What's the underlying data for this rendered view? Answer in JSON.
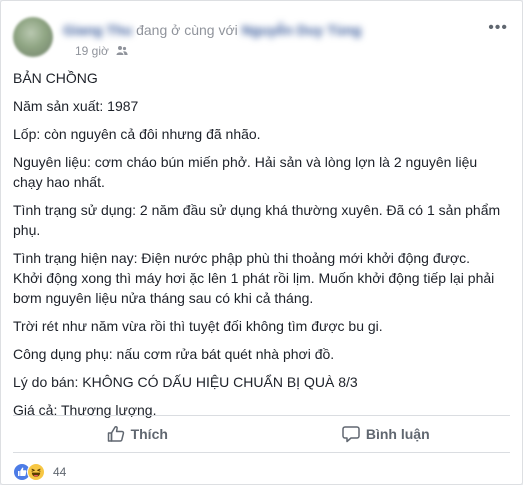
{
  "header": {
    "author_name": "Giang Thu",
    "with_text": "đang ở cùng với",
    "tagged_name": "Nguyễn Duy Tùng",
    "timestamp": "19 giờ",
    "audience_icon": "friends-icon",
    "more_icon": "more-icon"
  },
  "post": {
    "lines": [
      "BẢN CHỒNG",
      "Năm sản xuất: 1987",
      "Lốp: còn nguyên cả đôi nhưng đã nhão.",
      "Nguyên liệu: cơm cháo bún miến phở. Hải sản và lòng lợn là 2 nguyên liệu chạy hao nhất.",
      "Tình trạng sử dụng: 2 năm đầu sử dụng khá thường xuyên. Đã có 1 sản phẩm phụ.",
      "Tình trạng hiện nay: Điện nước phập phù thi thoảng mới khởi động được. Khởi động xong thì máy hơi ặc lên 1 phát rồi lịm. Muốn khởi động tiếp lại phải bơm nguyên liệu nửa tháng sau có khi cả tháng.",
      "Trời rét như năm vừa rồi thì tuyệt đối không tìm được bu gi.",
      "Công dụng phụ: nấu cơm rửa bát quét nhà phơi đồ.",
      "Lý do bán: KHÔNG CÓ DẤU HIỆU CHUẨN BỊ QUÀ 8/3",
      "Giá cả: Thương lượng."
    ]
  },
  "actions": {
    "like_label": "Thích",
    "comment_label": "Bình luận"
  },
  "reactions": {
    "count": "44",
    "icons": [
      "like-icon",
      "haha-icon"
    ],
    "colors": {
      "like": "#4d7ce6",
      "haha": "#f7c744"
    }
  }
}
